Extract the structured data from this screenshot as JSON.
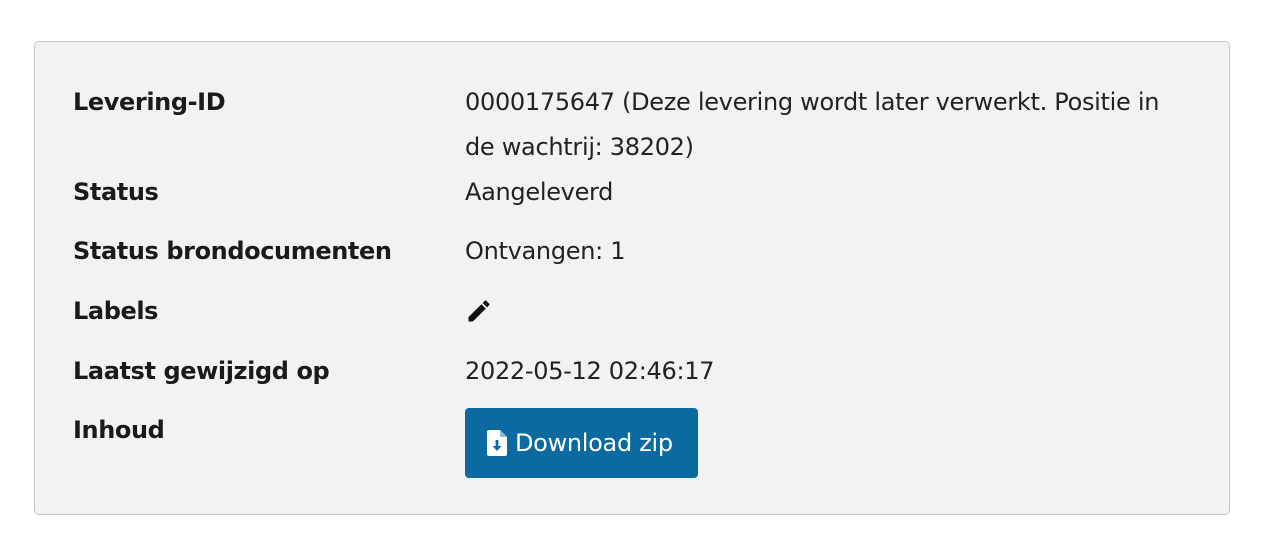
{
  "rows": {
    "id": {
      "label": "Levering-ID",
      "value": "0000175647 (Deze levering wordt later verwerkt. Positie in de wachtrij: 38202)"
    },
    "status": {
      "label": "Status",
      "value": "Aangeleverd"
    },
    "brondocumenten": {
      "label": "Status brondocumenten",
      "value": "Ontvangen: 1"
    },
    "labels": {
      "label": "Labels",
      "icon": "pencil-icon"
    },
    "date": {
      "label": "Laatst gewijzigd op",
      "value": "2022-05-12 02:46:17"
    },
    "inhoud": {
      "label": "Inhoud",
      "button_label": "Download zip",
      "button_icon": "file-download-icon",
      "button_color": "#0b6aa0"
    }
  }
}
